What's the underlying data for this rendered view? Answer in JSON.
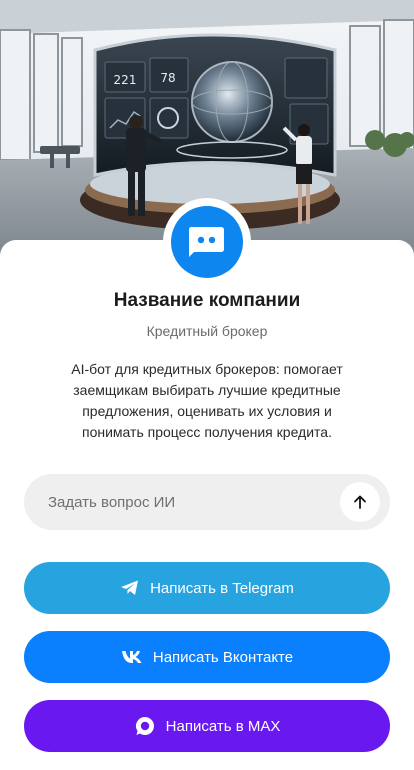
{
  "company": {
    "name": "Название компании",
    "category": "Кредитный брокер",
    "description": "AI-бот для кредитных брокеров: помогает заемщикам выбирать лучшие кредитные предложения, оценивать их условия и понимать процесс получения кредита."
  },
  "ask": {
    "placeholder": "Задать вопрос ИИ",
    "send_icon": "arrow-up-icon"
  },
  "actions": [
    {
      "label": "Написать в Telegram",
      "icon": "telegram-icon",
      "color": "#27a4e0"
    },
    {
      "label": "Написать Вконтакте",
      "icon": "vk-icon",
      "color": "#0b80ff"
    },
    {
      "label": "Написать в MAX",
      "icon": "max-icon",
      "color": "#6a18f0"
    }
  ],
  "hero": {
    "screen_numbers": [
      "221",
      "78"
    ]
  },
  "colors": {
    "avatar": "#0d86f0",
    "ask_background": "#efefef"
  }
}
